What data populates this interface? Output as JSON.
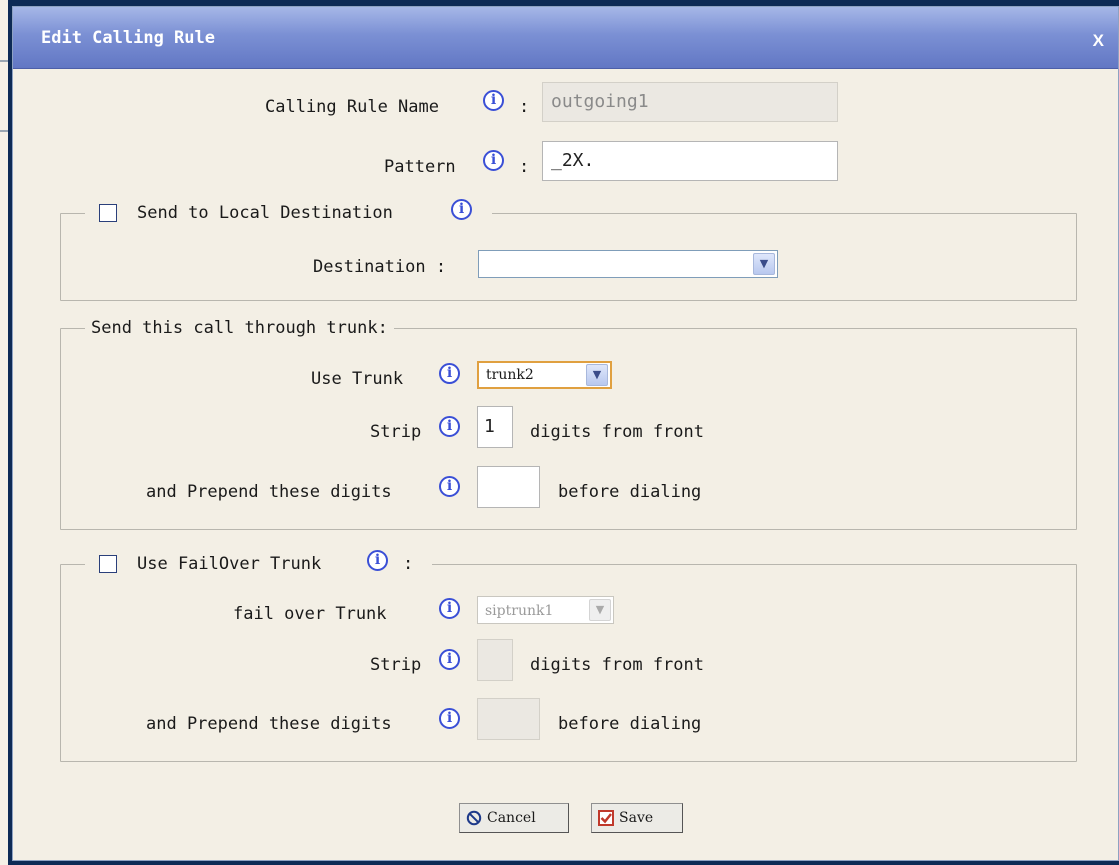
{
  "dialog": {
    "title": "Edit Calling Rule",
    "close": "X"
  },
  "rule_name": {
    "label": "Calling Rule Name",
    "colon": ":",
    "value": "outgoing1"
  },
  "pattern": {
    "label": "Pattern",
    "colon": ":",
    "value": "_2X."
  },
  "local": {
    "legend": "Send to Local Destination",
    "checked": false,
    "destination_label": "Destination :",
    "destination_value": ""
  },
  "trunk": {
    "legend": "Send this call through trunk:",
    "use_trunk_label": "Use Trunk",
    "use_trunk_value": "trunk2",
    "strip_label": "Strip",
    "strip_value": "1",
    "strip_suffix": "digits from front",
    "prepend_label": "and Prepend these digits",
    "prepend_value": "",
    "prepend_suffix": "before dialing"
  },
  "failover": {
    "legend": "Use FailOver Trunk",
    "legend_colon": ":",
    "checked": false,
    "trunk_label": "fail over Trunk",
    "trunk_value": "siptrunk1",
    "strip_label": "Strip",
    "strip_value": "",
    "strip_suffix": "digits from front",
    "prepend_label": "and Prepend these digits",
    "prepend_value": "",
    "prepend_suffix": "before dialing"
  },
  "buttons": {
    "cancel": "Cancel",
    "save": "Save"
  },
  "icons": {
    "info": "info-icon",
    "dropdown": "chevron-down-icon",
    "cancel": "prohibit-icon",
    "save": "checkbox-checked-icon"
  },
  "colors": {
    "title_bar": "#6e84cc",
    "dialog_bg": "#f3efe5",
    "info_icon": "#3a4fd6",
    "outer_bg": "#0d2a55"
  }
}
